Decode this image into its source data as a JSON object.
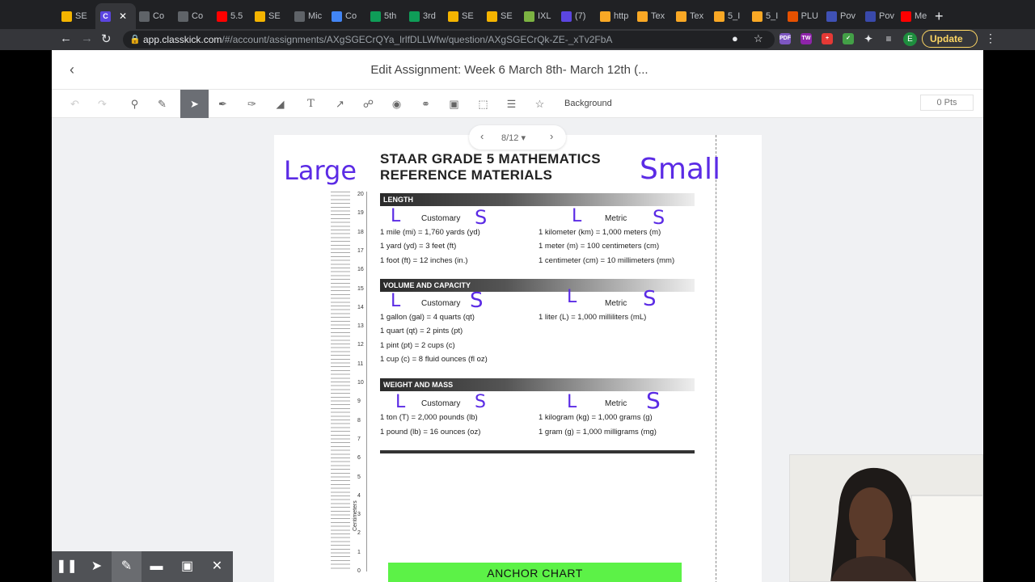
{
  "browser": {
    "tabs": [
      {
        "label": "SE",
        "color": "#f4b400"
      },
      {
        "label": "C",
        "color": "#5b45e0",
        "active": true
      },
      {
        "label": "Co",
        "color": "#5f6368"
      },
      {
        "label": "Co",
        "color": "#5f6368"
      },
      {
        "label": "5.5",
        "color": "#ff0000"
      },
      {
        "label": "SE",
        "color": "#f4b400"
      },
      {
        "label": "Mic",
        "color": "#5f6368"
      },
      {
        "label": "Co",
        "color": "#4285f4"
      },
      {
        "label": "5th",
        "color": "#0f9d58"
      },
      {
        "label": "3rd",
        "color": "#0f9d58"
      },
      {
        "label": "SE",
        "color": "#f4b400"
      },
      {
        "label": "SE",
        "color": "#f4b400"
      },
      {
        "label": "IXL",
        "color": "#7cb342"
      },
      {
        "label": "(7)",
        "color": "#5b45e0"
      },
      {
        "label": "http",
        "color": "#f9a825"
      },
      {
        "label": "Tex",
        "color": "#f9a825"
      },
      {
        "label": "Tex",
        "color": "#f9a825"
      },
      {
        "label": "5_I",
        "color": "#f9a825"
      },
      {
        "label": "5_I",
        "color": "#f9a825"
      },
      {
        "label": "PLU",
        "color": "#e65100"
      },
      {
        "label": "Pov",
        "color": "#3f51b5"
      },
      {
        "label": "Pov",
        "color": "#3949ab"
      },
      {
        "label": "Me",
        "color": "#ff0000"
      }
    ],
    "active_tab_glyph": "C",
    "url_host": "app.classkick.com",
    "url_path": "/#/account/assignments/AXgSGECrQYa_lrlfDLLWfw/question/AXgSGECrQk-ZE-_xTv2FbA",
    "profile_initial": "E",
    "update_label": "Update"
  },
  "app": {
    "title": "Edit Assignment: Week 6 March 8th- March 12th (...",
    "background_label": "Background",
    "points_label": "0 Pts",
    "pager_label": "8/12 ▾"
  },
  "sheet": {
    "title_line1": "STAAR GRADE 5 MATHEMATICS",
    "title_line2": "REFERENCE MATERIALS",
    "ruler_label": "Centimeters",
    "ruler_numbers": [
      "20",
      "19",
      "18",
      "17",
      "16",
      "15",
      "14",
      "13",
      "12",
      "11",
      "10",
      "9",
      "8",
      "7",
      "6",
      "5",
      "4",
      "3",
      "2",
      "1",
      "0"
    ],
    "sections": [
      {
        "heading": "LENGTH",
        "customary_label": "Customary",
        "metric_label": "Metric",
        "customary": [
          "1 mile (mi) = 1,760 yards (yd)",
          "1 yard (yd) = 3 feet (ft)",
          "1 foot (ft) = 12 inches (in.)"
        ],
        "metric": [
          "1 kilometer (km) = 1,000 meters (m)",
          "1 meter (m) = 100 centimeters (cm)",
          "1 centimeter (cm) = 10 millimeters (mm)"
        ]
      },
      {
        "heading": "VOLUME AND CAPACITY",
        "customary_label": "Customary",
        "metric_label": "Metric",
        "customary": [
          "1 gallon (gal) = 4 quarts (qt)",
          "1 quart (qt) = 2 pints (pt)",
          "1 pint (pt) = 2 cups (c)",
          "1 cup (c) = 8 fluid ounces (fl oz)"
        ],
        "metric": [
          "1 liter (L) = 1,000 milliliters (mL)"
        ]
      },
      {
        "heading": "WEIGHT AND MASS",
        "customary_label": "Customary",
        "metric_label": "Metric",
        "customary": [
          "1 ton (T) = 2,000 pounds (lb)",
          "1 pound (lb) = 16 ounces (oz)"
        ],
        "metric": [
          "1 kilogram (kg) = 1,000 grams (g)",
          "1 gram (g) = 1,000 milligrams (mg)"
        ]
      }
    ],
    "handwriting": {
      "large": "Large",
      "small": "Small",
      "L": "L",
      "S": "S",
      "ink_color": "#5b2be5"
    },
    "anchor_label": "ANCHOR CHART",
    "anchor_color": "#5cf247"
  }
}
